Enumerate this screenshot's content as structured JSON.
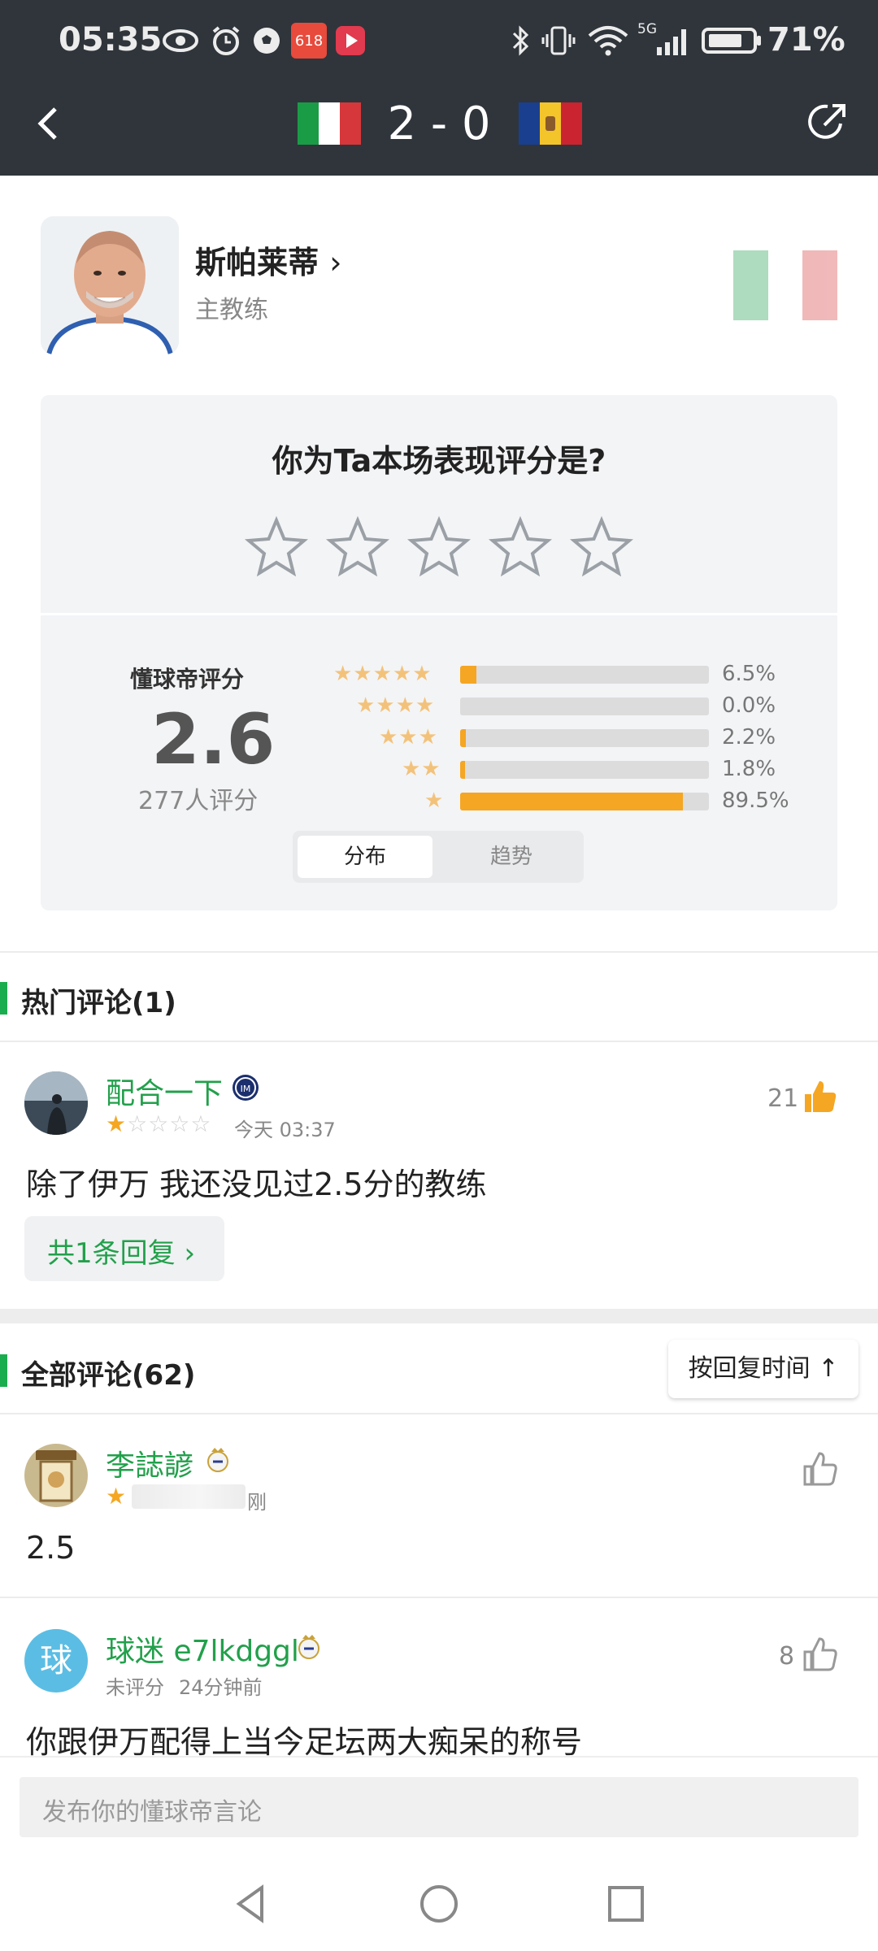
{
  "status_bar": {
    "time": "05:35",
    "battery": "71%",
    "network": "5G",
    "app_badge": "618",
    "icons": [
      "eye-icon",
      "alarm-icon",
      "football-icon",
      "app-618-icon",
      "video-app-icon",
      "bluetooth-icon",
      "vibrate-icon",
      "wifi-icon",
      "signal-icon",
      "battery-icon"
    ]
  },
  "header": {
    "score": "2 - 0",
    "home_flag_colors": [
      "#1a9c47",
      "#ffffff",
      "#d6373a"
    ],
    "away_flag_colors": [
      "#1a3f8f",
      "#f4c42b",
      "#c9242f"
    ]
  },
  "coach": {
    "name": "斯帕莱蒂",
    "role": "主教练"
  },
  "rating": {
    "question": "你为Ta本场表现评分是?",
    "user_stars": 0,
    "label": "懂球帝评分",
    "score": "2.6",
    "count": "277人评分",
    "distribution": [
      {
        "stars": 5,
        "pct_text": "6.5%",
        "pct": 6.5
      },
      {
        "stars": 4,
        "pct_text": "0.0%",
        "pct": 0.0
      },
      {
        "stars": 3,
        "pct_text": "2.2%",
        "pct": 2.2
      },
      {
        "stars": 2,
        "pct_text": "1.8%",
        "pct": 1.8
      },
      {
        "stars": 1,
        "pct_text": "89.5%",
        "pct": 89.5
      }
    ],
    "tabs": [
      "分布",
      "趋势"
    ]
  },
  "hot_section": {
    "title": "热门评论(1)",
    "comment": {
      "user": "配合一下",
      "stars": 1,
      "time": "今天 03:37",
      "likes": "21",
      "text": "除了伊万 我还没见过2.5分的教练",
      "replies": "共1条回复 ›"
    }
  },
  "all_section": {
    "title": "全部评论(62)",
    "sort_label": "按回复时间 ↑",
    "comments": [
      {
        "user": "李誌諺",
        "stars": 1,
        "time": "刚",
        "likes": "",
        "text": "2.5"
      },
      {
        "user": "球迷 e7lkdggl",
        "avatar_char": "球",
        "status": "未评分",
        "time": "24分钟前",
        "likes": "8",
        "text": "你跟伊万配得上当今足坛两大痴呆的称号"
      }
    ]
  },
  "input": {
    "placeholder": "发布你的懂球帝言论"
  },
  "colors": {
    "header_bg": "#2f353b",
    "accent_green": "#22a04b",
    "star_orange": "#f5a623"
  }
}
